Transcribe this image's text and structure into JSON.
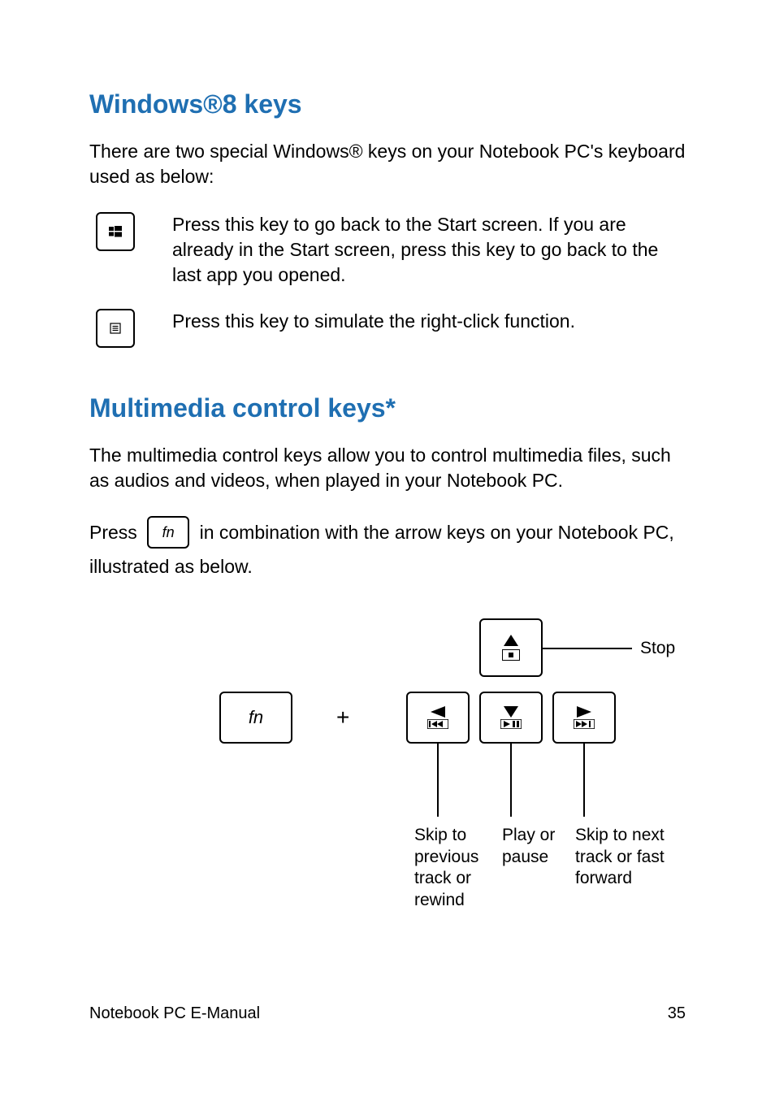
{
  "sections": {
    "win": {
      "title": "Windows®8 keys",
      "intro": "There are two special Windows® keys on your Notebook PC's keyboard used as below:",
      "key1_desc": "Press this key to go back to the Start screen. If you are already in the Start screen, press this key to go back to the last app you opened.",
      "key2_desc": "Press this key to simulate the right-click function."
    },
    "mm": {
      "title": "Multimedia control keys*",
      "intro": "The multimedia control keys allow you to control multimedia files, such as audios and videos, when played in your Notebook PC.",
      "press_pre": "Press ",
      "press_post": " in combination with the arrow keys on your Notebook PC, illustrated as below.",
      "fn_label": "fn",
      "plus": "+",
      "labels": {
        "stop": "Stop",
        "prev": "Skip to previous track or rewind",
        "play": "Play or pause",
        "next": "Skip to next track or fast forward"
      }
    }
  },
  "footer": {
    "title": "Notebook PC E-Manual",
    "page": "35"
  }
}
